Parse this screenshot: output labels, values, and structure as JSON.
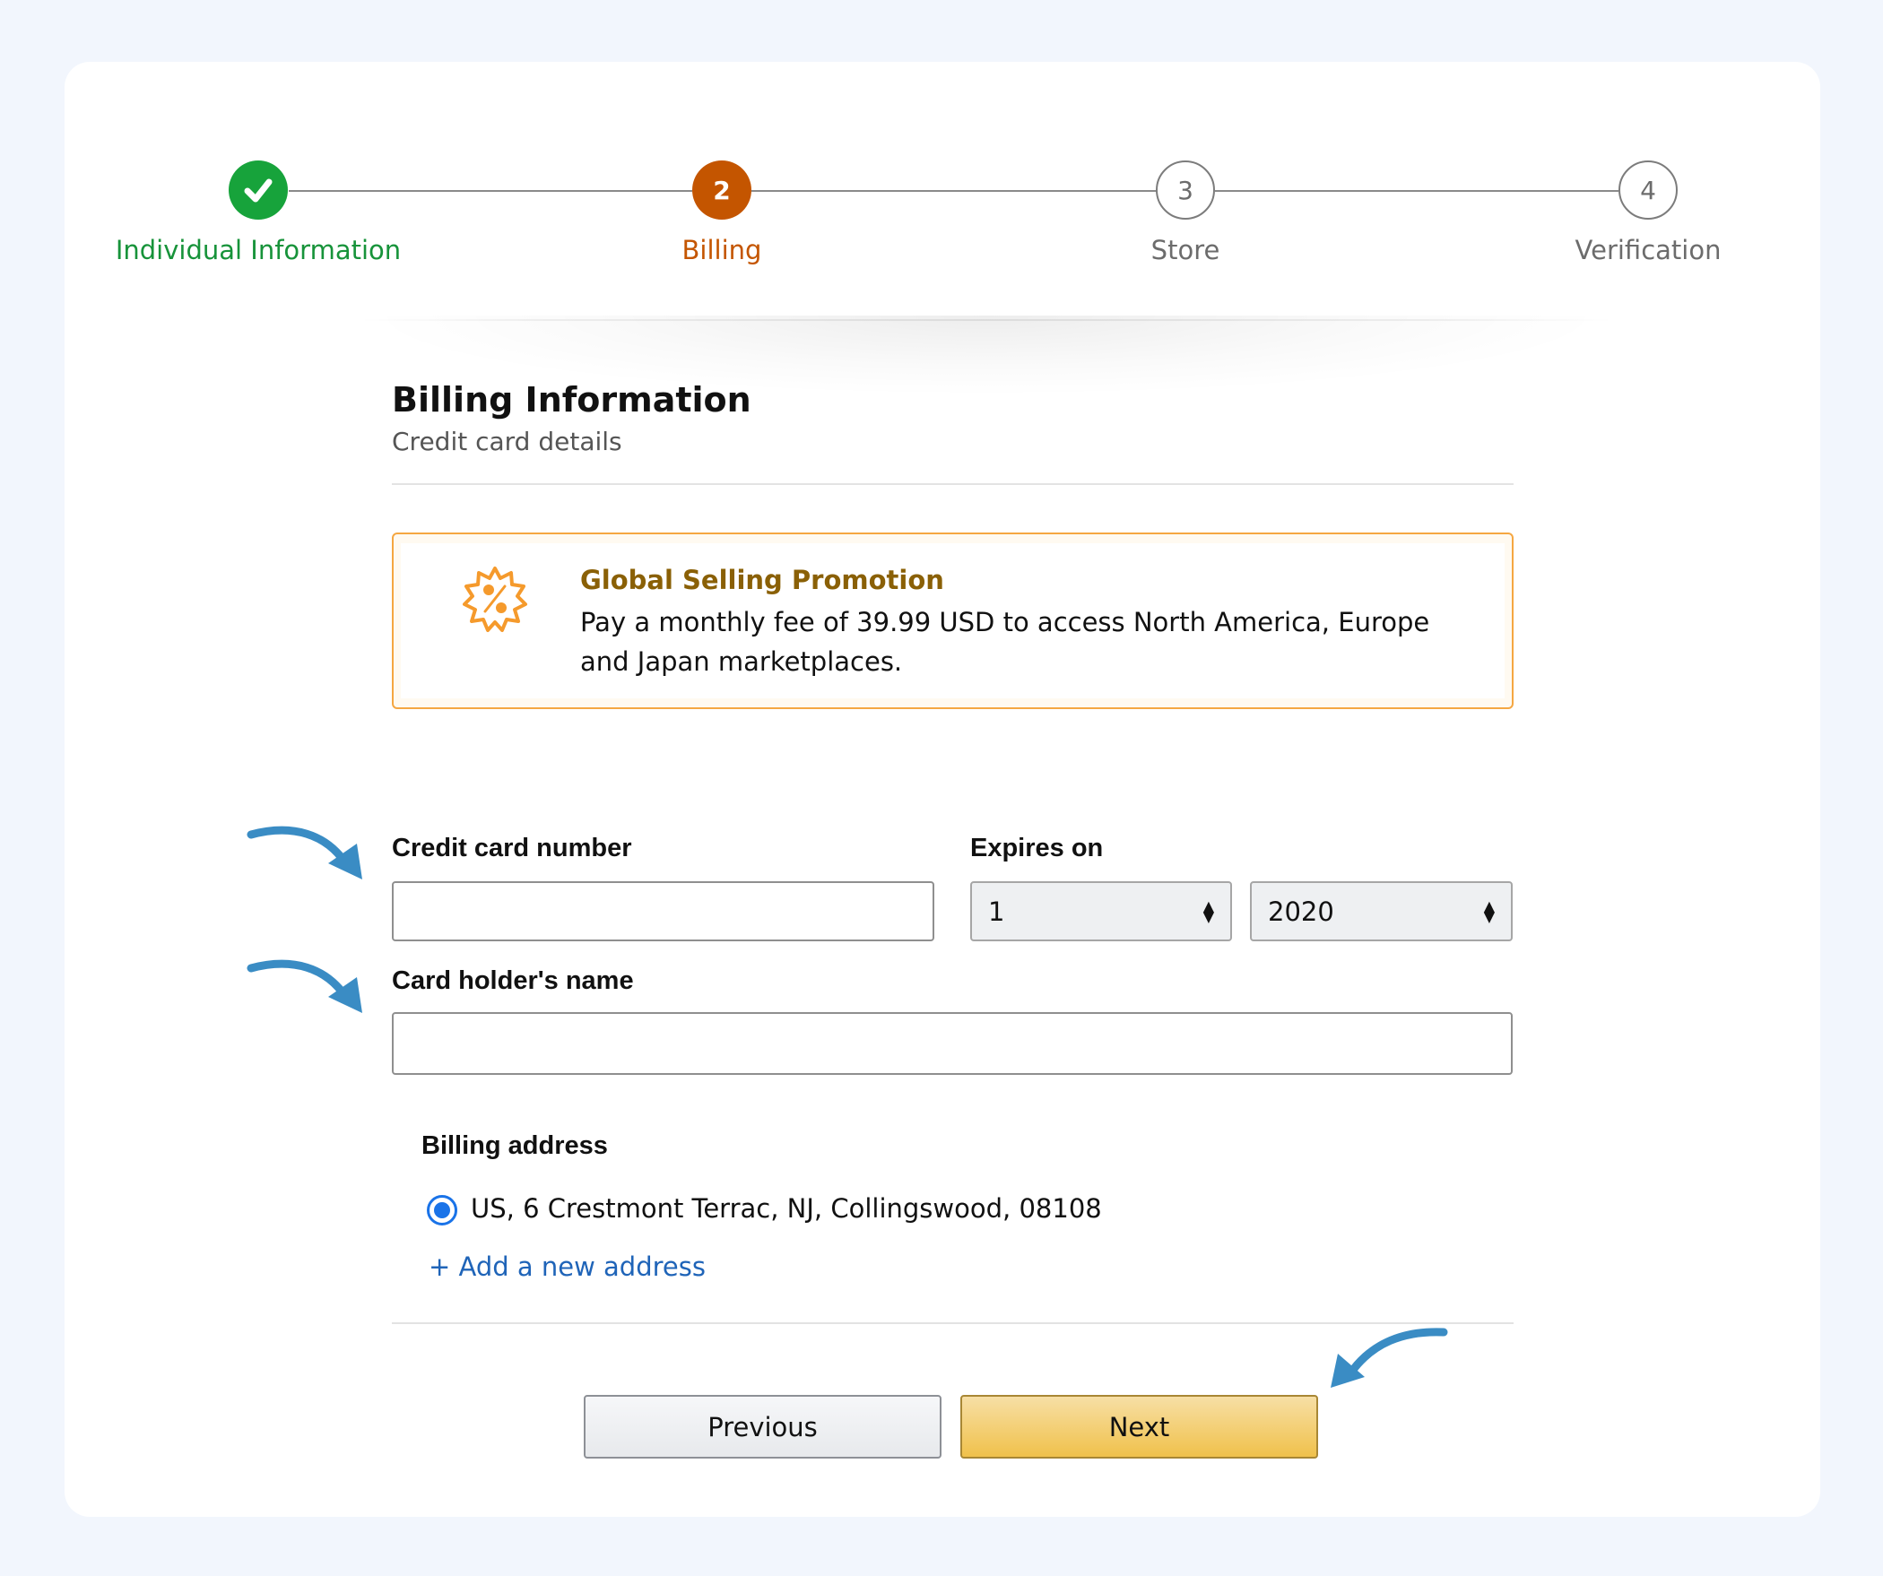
{
  "stepper": {
    "steps": [
      {
        "number": "",
        "label": "Individual Information",
        "state": "completed",
        "color": "#17a33b"
      },
      {
        "number": "2",
        "label": "Billing",
        "state": "active",
        "color": "#c45500"
      },
      {
        "number": "3",
        "label": "Store",
        "state": "pending",
        "color": "#6c6c6c"
      },
      {
        "number": "4",
        "label": "Verification",
        "state": "pending",
        "color": "#6c6c6c"
      }
    ]
  },
  "section": {
    "title": "Billing Information",
    "subtitle": "Credit card details"
  },
  "promo": {
    "icon": "discount-badge-icon",
    "title": "Global Selling Promotion",
    "body": "Pay a monthly fee of 39.99 USD to access North America, Europe and Japan marketplaces.",
    "accent": "#f5a742"
  },
  "form": {
    "card_number": {
      "label": "Credit card number",
      "value": "",
      "placeholder": ""
    },
    "expires": {
      "label": "Expires on",
      "month": {
        "value": "1"
      },
      "year": {
        "value": "2020"
      }
    },
    "card_holder": {
      "label": "Card holder's name",
      "value": "",
      "placeholder": ""
    },
    "billing_address": {
      "label": "Billing address",
      "options": [
        {
          "text": "US, 6 Crestmont Terrac, NJ, Collingswood, 08108",
          "selected": true
        }
      ],
      "add_link": "+ Add a new address"
    }
  },
  "actions": {
    "previous_label": "Previous",
    "next_label": "Next"
  },
  "annotations": {
    "arrow_color": "#3a8cc4"
  }
}
